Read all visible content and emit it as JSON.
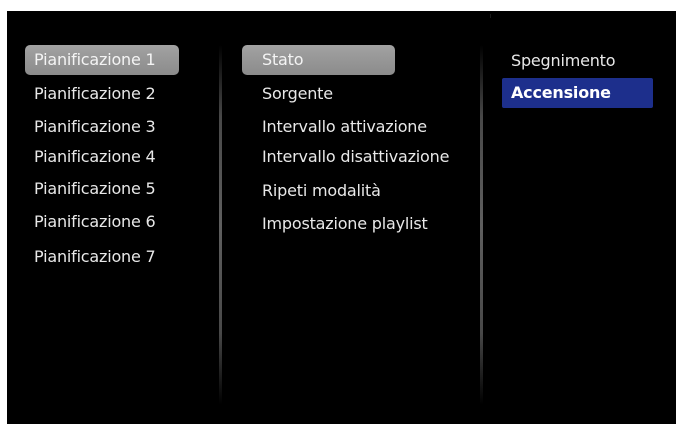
{
  "menu": {
    "schedules": [
      {
        "label": "Pianificazione 1"
      },
      {
        "label": "Pianificazione 2"
      },
      {
        "label": "Pianificazione 3"
      },
      {
        "label": "Pianificazione 4"
      },
      {
        "label": "Pianificazione 5"
      },
      {
        "label": "Pianificazione 6"
      },
      {
        "label": "Pianificazione 7"
      }
    ],
    "settings": [
      {
        "label": "Stato"
      },
      {
        "label": "Sorgente"
      },
      {
        "label": "Intervallo attivazione"
      },
      {
        "label": "Intervallo disattivazione"
      },
      {
        "label": "Ripeti modalità"
      },
      {
        "label": "Impostazione playlist"
      }
    ],
    "options": [
      {
        "label": "Spegnimento"
      },
      {
        "label": "Accensione"
      }
    ]
  },
  "state": {
    "focused_schedule": "Pianificazione 1",
    "focused_setting": "Stato",
    "selected_option": "Accensione"
  },
  "colors": {
    "background": "#000000",
    "text": "#e8e8e8",
    "focus_highlight": "#9a9a9a",
    "selection_highlight": "#1d2f8c"
  }
}
